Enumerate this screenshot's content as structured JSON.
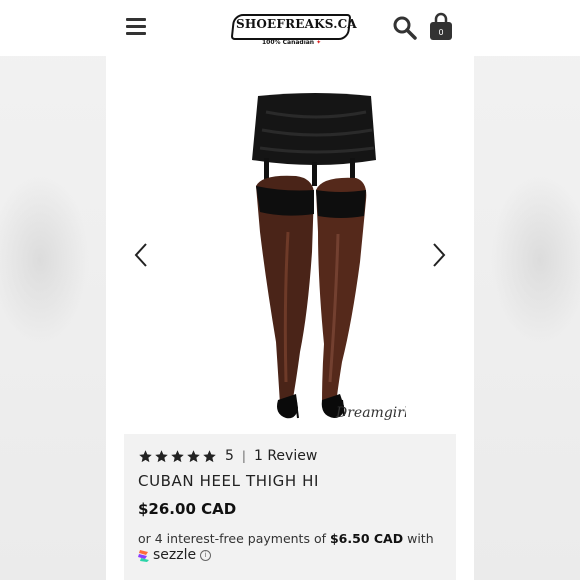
{
  "header": {
    "logo_text": "SHOEFREAKS.CA",
    "logo_subtext": "100% Canadian",
    "cart_count": "0"
  },
  "gallery": {
    "watermark": "Dreamgirl"
  },
  "product": {
    "rating_value": "5",
    "stars": 5,
    "reviews_label": "1 Review",
    "title": "CUBAN HEEL THIGH HI",
    "price": "$26.00 CAD",
    "installments_prefix": "or 4 interest-free payments of",
    "installment_amount": "$6.50 CAD",
    "installments_suffix": "with",
    "sezzle_label": "sezzle",
    "info_symbol": "i"
  },
  "colors": {
    "star": "#222222",
    "panel_bg": "#f2f2f2",
    "sezzle_icon": [
      "#ff6b3d",
      "#8b3dff",
      "#2bd4a8"
    ]
  }
}
